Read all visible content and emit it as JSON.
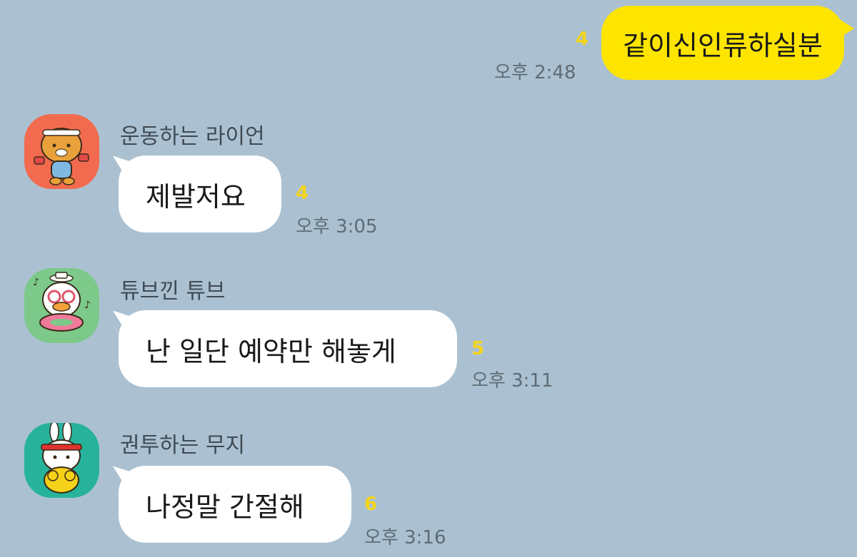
{
  "chat": {
    "background_color": "#abc1d1",
    "my_bubble_color": "#fee500",
    "unread_color": "#f4d51b",
    "messages": [
      {
        "from_me": true,
        "text": "같이신인류하실분",
        "unread": "4",
        "time": "오후 2:48"
      },
      {
        "from_me": false,
        "sender": "운동하는 라이언",
        "avatar_icon": "ryan-exercising-icon",
        "avatar_color": "#f26b4e",
        "text": "제발저요",
        "unread": "4",
        "time": "오후 3:05"
      },
      {
        "from_me": false,
        "sender": "튜브낀 튜브",
        "avatar_icon": "tube-duck-icon",
        "avatar_color": "#7cc98a",
        "text": "난 일단 예약만 해놓게",
        "unread": "5",
        "time": "오후 3:11"
      },
      {
        "from_me": false,
        "sender": "권투하는 무지",
        "avatar_icon": "muzi-boxing-icon",
        "avatar_color": "#27b39b",
        "text": "나정말 간절해",
        "unread": "6",
        "time": "오후 3:16"
      }
    ]
  }
}
